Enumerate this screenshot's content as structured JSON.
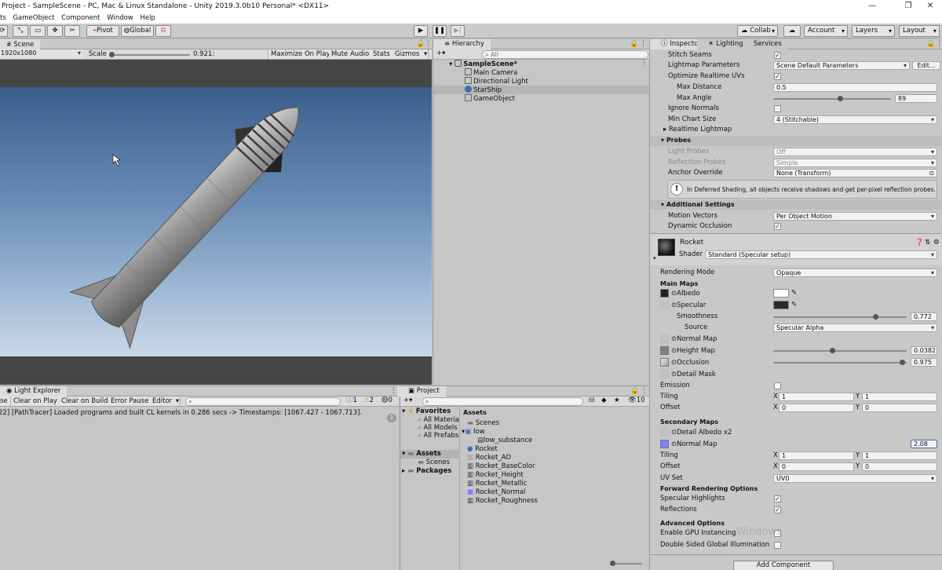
{
  "window": {
    "title": "Project - SampleScene - PC, Mac & Linux Standalone - Unity 2019.3.0b10 Personal* <DX11>"
  },
  "menu": [
    "ts",
    "GameObject",
    "Component",
    "Window",
    "Help"
  ],
  "toolbar": {
    "pivot": "Pivot",
    "global": "Global",
    "collab": "Collab",
    "account": "Account",
    "layers": "Layers",
    "layout": "Layout"
  },
  "scene": {
    "tab": "Scene",
    "resolution": "1920x1080",
    "scale_label": "Scale",
    "scale_value": "0.921:",
    "scale_fraction": 0.921,
    "options": [
      "Maximize On Play",
      "Mute Audio",
      "Stats",
      "Gizmos"
    ]
  },
  "hierarchy": {
    "tab": "Hierarchy",
    "search_placeholder": "All",
    "scene": "SampleScene*",
    "items": [
      "Main Camera",
      "Directional Light",
      "StarShip",
      "GameObject"
    ]
  },
  "inspector": {
    "tabs": [
      "Inspector",
      "Lighting",
      "Services"
    ],
    "rows": {
      "stitch_seams": "Stitch Seams",
      "lightmap_parameters": "Lightmap Parameters",
      "lightmap_parameters_value": "Scene Default Parameters",
      "edit_btn": "Edit...",
      "optimize_uvs": "Optimize Realtime UVs",
      "max_distance": "Max Distance",
      "max_distance_value": "0.5",
      "max_angle": "Max Angle",
      "max_angle_value": "89",
      "ignore_normals": "Ignore Normals",
      "min_chart_size": "Min Chart Size",
      "min_chart_size_value": "4 (Stitchable)",
      "realtime_lightmap": "Realtime Lightmap",
      "probes": "Probes",
      "light_probes": "Light Probes",
      "light_probes_value": "Off",
      "reflection_probes": "Reflection Probes",
      "reflection_probes_value": "Simple",
      "anchor_override": "Anchor Override",
      "anchor_override_value": "None (Transform)",
      "info_text": "In Deferred Shading, all objects receive shadows and get per-pixel reflection probes.",
      "additional_settings": "Additional Settings",
      "motion_vectors": "Motion Vectors",
      "motion_vectors_value": "Per Object Motion",
      "dynamic_occlusion": "Dynamic Occlusion"
    },
    "material": {
      "name": "Rocket",
      "shader_label": "Shader",
      "shader_value": "Standard (Specular setup)",
      "rendering_mode": "Rendering Mode",
      "rendering_mode_value": "Opaque",
      "main_maps": "Main Maps",
      "albedo": "Albedo",
      "specular": "Specular",
      "smoothness": "Smoothness",
      "smoothness_value": "0.772",
      "source": "Source",
      "source_value": "Specular Alpha",
      "normal_map": "Normal Map",
      "height_map": "Height Map",
      "height_value": "0.0382",
      "occlusion": "Occlusion",
      "occlusion_value": "0.975",
      "detail_mask": "Detail Mask",
      "emission": "Emission",
      "tiling": "Tiling",
      "offset": "Offset",
      "x": "X",
      "y": "Y",
      "tiling_x": "1",
      "tiling_y": "1",
      "offset_x": "0",
      "offset_y": "0",
      "secondary_maps": "Secondary Maps",
      "detail_albedo": "Detail Albedo x2",
      "sec_normal_map": "Normal Map",
      "sec_normal_value": "2.08",
      "sec_tiling_x": "1",
      "sec_tiling_y": "1",
      "sec_offset_x": "0",
      "sec_offset_y": "0",
      "uv_set": "UV Set",
      "uv_set_value": "UV0",
      "forward_options": "Forward Rendering Options",
      "specular_highlights": "Specular Highlights",
      "reflections": "Reflections",
      "advanced_options": "Advanced Options",
      "gpu_instancing": "Enable GPU Instancing",
      "double_sided_gi": "Double Sided Global Illumination",
      "add_component": "Add Component",
      "watermark": "Windows"
    }
  },
  "console": {
    "tab": "Light Explorer",
    "buttons": [
      "se",
      "Clear on Play",
      "Clear on Build",
      "Error Pause",
      "Editor"
    ],
    "counts": [
      "1",
      "2",
      "0"
    ],
    "message": "22] [PathTracer] Loaded programs and built CL kernels in 0.286 secs -> Timestamps: [1067.427 - 1067.713].",
    "message_count": "1"
  },
  "project": {
    "tab": "Project",
    "hidden_count": "10",
    "favorites": "Favorites",
    "favorites_items": [
      "All Materia",
      "All Models",
      "All Prefabs"
    ],
    "assets": "Assets",
    "assets_children": [
      "Scenes"
    ],
    "packages": "Packages",
    "assets_header": "Assets",
    "files": [
      "Scenes",
      "low",
      "low_substance",
      "Rocket",
      "Rocket_AO",
      "Rocket_BaseColor",
      "Rocket_Height",
      "Rocket_Metallic",
      "Rocket_Normal",
      "Rocket_Roughness"
    ]
  },
  "colors": {
    "accent": "#3d6fb0",
    "panel": "#c2c2c2",
    "sky_top": "#3b5d8c",
    "sky_bottom": "#c9d8e8",
    "ground": "#464646"
  }
}
